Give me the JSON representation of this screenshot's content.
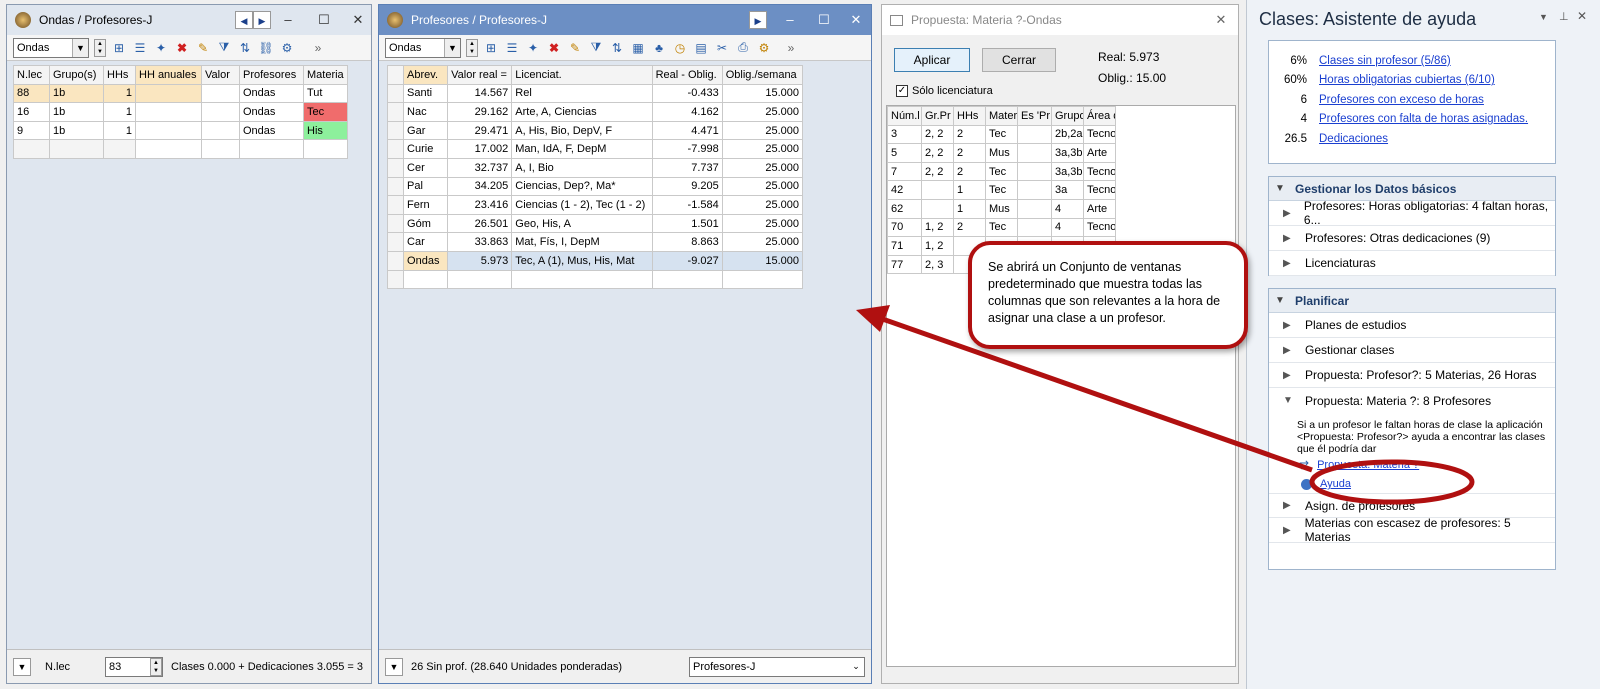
{
  "win1": {
    "title": "Ondas / Profesores-J",
    "combo_value": "Ondas",
    "columns": [
      "N.lec",
      "Grupo(s)",
      "HHs",
      "HH anuales",
      "Valor",
      "Profesores",
      "Materia"
    ],
    "rows": [
      [
        "88",
        "1b",
        "1",
        "",
        "",
        "Ondas",
        "Tut"
      ],
      [
        "16",
        "1b",
        "1",
        "",
        "",
        "Ondas",
        "Tec"
      ],
      [
        "9",
        "1b",
        "1",
        "",
        "",
        "Ondas",
        "His"
      ]
    ],
    "status_label": "N.lec",
    "status_value": "83",
    "status_text": "Clases 0.000 + Dedicaciones 3.055 = 3"
  },
  "win2": {
    "title": "Profesores / Profesores-J",
    "combo_value": "Ondas",
    "columns": [
      "Abrev.",
      "Valor real =",
      "Licenciat.",
      "Real - Oblig.",
      "Oblig./semana"
    ],
    "rows": [
      [
        "Santi",
        "14.567",
        "Rel",
        "-0.433",
        "15.000"
      ],
      [
        "Nac",
        "29.162",
        "Arte, A, Ciencias",
        "4.162",
        "25.000"
      ],
      [
        "Gar",
        "29.471",
        "A, His, Bio, DepV, F",
        "4.471",
        "25.000"
      ],
      [
        "Curie",
        "17.002",
        "Man, IdA, F, DepM",
        "-7.998",
        "25.000"
      ],
      [
        "Cer",
        "32.737",
        "A, I, Bio",
        "7.737",
        "25.000"
      ],
      [
        "Pal",
        "34.205",
        "Ciencias, Dep?, Ma*",
        "9.205",
        "25.000"
      ],
      [
        "Fern",
        "23.416",
        "Ciencias (1 - 2), Tec (1 - 2)",
        "-1.584",
        "25.000"
      ],
      [
        "Góm",
        "26.501",
        "Geo, His, A",
        "1.501",
        "25.000"
      ],
      [
        "Car",
        "33.863",
        "Mat, Fís, I, DepM",
        "8.863",
        "25.000"
      ],
      [
        "Ondas",
        "5.973",
        "Tec, A (1), Mus, His, Mat",
        "-9.027",
        "15.000"
      ]
    ],
    "status_text": "26 Sin prof. (28.640 Unidades ponderadas)",
    "status_combo": "Profesores-J"
  },
  "win3": {
    "title": "Propuesta: Materia ?-Ondas",
    "apply_label": "Aplicar",
    "close_label": "Cerrar",
    "real": "Real: 5.973",
    "oblig": "Oblig.: 15.00",
    "checkbox_label": "Sólo licenciatura",
    "columns": [
      "Núm.l",
      "Gr.Pr",
      "HHs",
      "Mater",
      "Es 'Pr",
      "Grupo",
      "Área d"
    ],
    "rows": [
      [
        "3",
        "2, 2",
        "2",
        "Tec",
        "",
        "2b,2a",
        "Tecno"
      ],
      [
        "5",
        "2, 2",
        "2",
        "Mus",
        "",
        "3a,3b",
        "Arte"
      ],
      [
        "7",
        "2, 2",
        "2",
        "Tec",
        "",
        "3a,3b",
        "Tecno"
      ],
      [
        "42",
        "",
        "1",
        "Tec",
        "",
        "3a",
        "Tecno"
      ],
      [
        "62",
        "",
        "1",
        "Mus",
        "",
        "4",
        "Arte"
      ],
      [
        "70",
        "1, 2",
        "2",
        "Tec",
        "",
        "4",
        "Tecno"
      ],
      [
        "71",
        "1, 2",
        "",
        "",
        "",
        "",
        ""
      ],
      [
        "77",
        "2, 3",
        "",
        "",
        "",
        "",
        ""
      ]
    ]
  },
  "callout": {
    "text": "Se abrirá un Conjunto de ventanas predeterminado que muestra todas las columnas que son relevantes a la hora de asignar una clase a un profesor."
  },
  "assistant": {
    "title": "Clases: Asistente de ayuda",
    "stats": [
      {
        "n": "6%",
        "label": "Clases sin profesor (5/86)"
      },
      {
        "n": "60%",
        "label": "Horas obligatorias cubiertas (6/10)"
      },
      {
        "n": "6",
        "label": "Profesores con exceso de horas"
      },
      {
        "n": "4",
        "label": "Profesores con falta de horas asignadas."
      },
      {
        "n": "26.5",
        "label": "Dedicaciones"
      }
    ],
    "section1": {
      "title": "Gestionar los Datos básicos",
      "items": [
        "Profesores: Horas obligatorias: 4 faltan horas, 6...",
        "Profesores: Otras dedicaciones (9)",
        "Licenciaturas"
      ]
    },
    "section2": {
      "title": "Planificar",
      "items": [
        "Planes de estudios",
        "Gestionar clases",
        "Propuesta: Profesor?: 5 Materias, 26 Horas",
        "Propuesta: Materia ?: 8 Profesores"
      ],
      "desc": "Si a un profesor le faltan horas de clase la aplicación <Propuesta: Profesor?> ayuda a encontrar las clases que él podría dar",
      "link1": "Propuesta: Materia ?",
      "link2": "Ayuda",
      "items2": [
        "Asign. de profesores",
        "Materias con escasez de profesores: 5 Materias"
      ]
    }
  },
  "colors": {
    "red_cell": "#f06c6c",
    "green_cell": "#8df09c",
    "highlight": "#fae6c0",
    "selected_row": "#d6e2f0",
    "arrow": "#b01010"
  }
}
